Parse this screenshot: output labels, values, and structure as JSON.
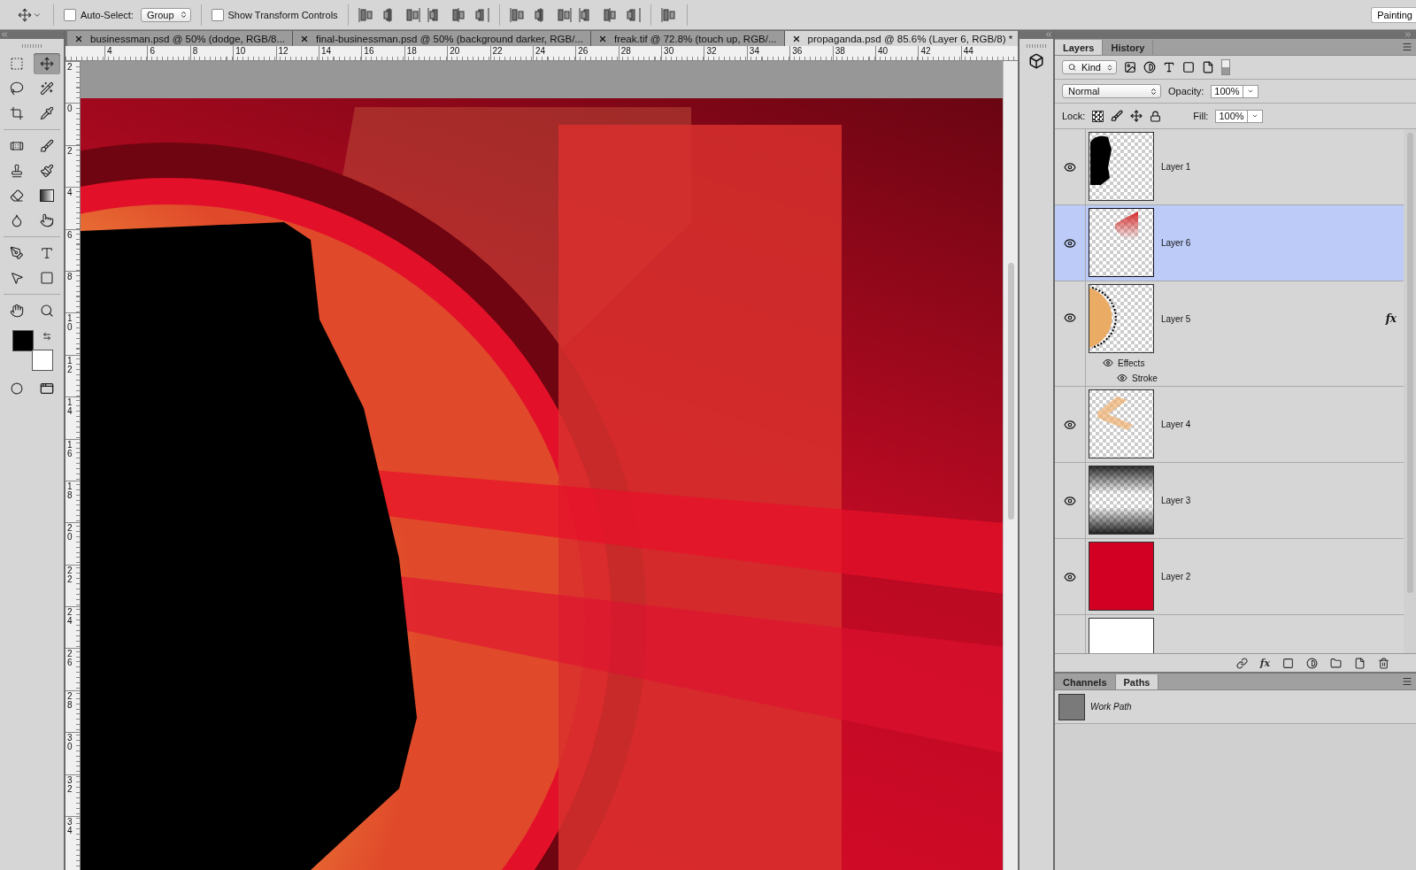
{
  "options_bar": {
    "tool_preset": {
      "kind": "move"
    },
    "auto_select": {
      "label": "Auto-Select:",
      "checked": false
    },
    "auto_select_target": "Group",
    "show_transform": {
      "label": "Show Transform Controls",
      "checked": false
    },
    "workspace": "Painting"
  },
  "toolbar": {
    "tools": [
      {
        "kind": "marquee",
        "selected": false
      },
      {
        "kind": "move",
        "selected": true
      },
      {
        "kind": "lasso",
        "selected": false
      },
      {
        "kind": "wand",
        "selected": false
      },
      {
        "kind": "crop",
        "selected": false
      },
      {
        "kind": "eyedropper",
        "selected": false
      },
      {
        "kind": "heal",
        "selected": false
      },
      {
        "kind": "brush",
        "selected": false
      },
      {
        "kind": "stamp",
        "selected": false
      },
      {
        "kind": "history",
        "selected": false
      },
      {
        "kind": "eraser",
        "selected": false
      },
      {
        "kind": "gradient",
        "selected": false
      },
      {
        "kind": "blur",
        "selected": false
      },
      {
        "kind": "smudge",
        "selected": false
      },
      {
        "kind": "pen",
        "selected": false
      },
      {
        "kind": "type",
        "selected": false
      },
      {
        "kind": "select",
        "selected": false
      },
      {
        "kind": "shape",
        "selected": false
      },
      {
        "kind": "hand",
        "selected": false
      },
      {
        "kind": "zoom",
        "selected": false
      }
    ],
    "swatches": [
      {
        "kind": "foreground",
        "color": "#000000"
      },
      {
        "kind": "background",
        "color": "#ffffff"
      }
    ]
  },
  "document_tabs": [
    {
      "label": "businessman.psd @ 50% (dodge, RGB/8...",
      "selected": false
    },
    {
      "label": "final-businessman.psd @ 50% (background darker, RGB/...",
      "selected": false
    },
    {
      "label": "freak.tif @ 72.8% (touch up, RGB/...",
      "selected": false
    },
    {
      "label": "propaganda.psd @ 85.6% (Layer 6, RGB/8) *",
      "selected": true
    }
  ],
  "rulers": {
    "horizontal": [
      "4",
      "6",
      "8",
      "10",
      "12",
      "14",
      "16",
      "18",
      "20",
      "22",
      "24",
      "26",
      "28",
      "30",
      "32",
      "34",
      "36",
      "38",
      "40",
      "42",
      "44"
    ],
    "vertical": [
      "2",
      "0",
      "2",
      "4",
      "6",
      "8",
      "10",
      "12",
      "14",
      "16",
      "18",
      "20",
      "22",
      "24",
      "26",
      "28",
      "30",
      "32",
      "34"
    ]
  },
  "layers_panel": {
    "tabs": [
      {
        "label": "Layers",
        "selected": true
      },
      {
        "label": "History",
        "selected": false
      }
    ],
    "filter": "Kind",
    "blend_mode": "Normal",
    "opacity_label": "Opacity:",
    "opacity": "100%",
    "lock_label": "Lock:",
    "fill_label": "Fill:",
    "fill": "100%",
    "layers": [
      {
        "name": "Layer 1",
        "visible": true,
        "selected": false,
        "kind": "silhouette"
      },
      {
        "name": "Layer 6",
        "visible": true,
        "selected": true,
        "kind": "corner"
      },
      {
        "name": "Layer 5",
        "visible": true,
        "selected": false,
        "kind": "half-circle",
        "fx": "fx",
        "effects": [
          {
            "label": "Effects",
            "visible": true,
            "children": [
              {
                "label": "Stroke",
                "visible": true
              }
            ]
          }
        ]
      },
      {
        "name": "Layer 4",
        "visible": true,
        "selected": false,
        "kind": "rays"
      },
      {
        "name": "Layer 3",
        "visible": true,
        "selected": false,
        "kind": "gradient"
      },
      {
        "name": "Layer 2",
        "visible": true,
        "selected": false,
        "kind": "solid"
      },
      {
        "kind": "blank"
      }
    ],
    "footer_fx": "fx"
  },
  "paths_panel": {
    "tabs": [
      {
        "label": "Channels",
        "selected": false
      },
      {
        "label": "Paths",
        "selected": true
      }
    ],
    "paths": [
      {
        "name": "Work Path"
      }
    ]
  }
}
